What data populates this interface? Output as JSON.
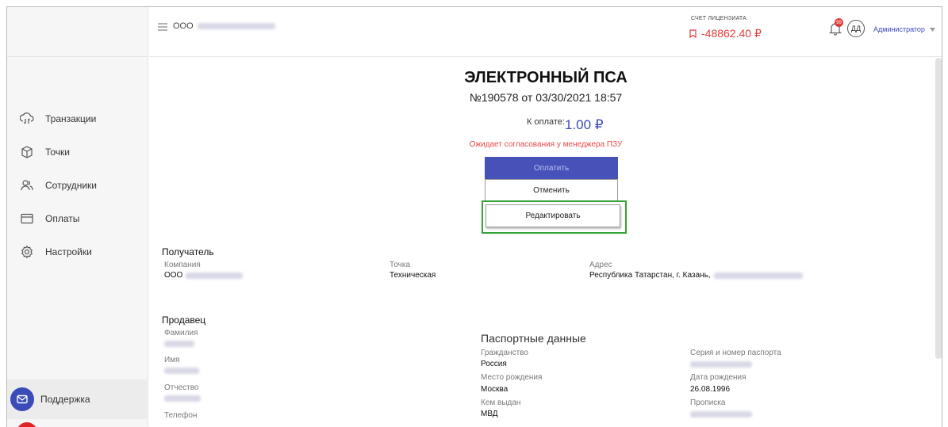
{
  "header": {
    "company_prefix": "ООО",
    "account_label": "СЧЕТ ЛИЦЕНЗИАТА",
    "balance": "-48862.40 ₽",
    "notification_count": "99",
    "avatar_initials": "ДД",
    "user_role": "Администратор"
  },
  "sidebar": {
    "items": [
      {
        "label": "Транзакции",
        "icon": "transactions-icon"
      },
      {
        "label": "Точки",
        "icon": "box-icon"
      },
      {
        "label": "Сотрудники",
        "icon": "users-icon"
      },
      {
        "label": "Оплаты",
        "icon": "card-icon"
      },
      {
        "label": "Настройки",
        "icon": "gear-icon"
      }
    ],
    "support_label": "Поддержка"
  },
  "document": {
    "title": "ЭЛЕКТРОННЫЙ ПСА",
    "subtitle": "№190578 от 03/30/2021 18:57",
    "amount_label": "К оплате:",
    "amount_value": "1.00 ₽",
    "status": "Ожидает согласования у менеджера ПЗУ"
  },
  "actions": {
    "pay": "Оплатить",
    "cancel": "Отменить",
    "edit": "Редактировать"
  },
  "recipient": {
    "heading": "Получатель",
    "company_label": "Компания",
    "company_prefix": "ООО",
    "point_label": "Точка",
    "point_value": "Техническая",
    "address_label": "Адрес",
    "address_value": "Республика Татарстан, г. Казань,"
  },
  "seller": {
    "heading": "Продавец",
    "surname_label": "Фамилия",
    "name_label": "Имя",
    "patronymic_label": "Отчество",
    "phone_label": "Телефон"
  },
  "passport": {
    "heading": "Паспортные данные",
    "citizenship_label": "Гражданство",
    "citizenship_value": "Россия",
    "birthplace_label": "Место рождения",
    "birthplace_value": "Москва",
    "issued_by_label": "Кем выдан",
    "issued_by_value": "МВД",
    "series_label": "Серия и номер паспорта",
    "birthdate_label": "Дата рождения",
    "birthdate_value": "26.08.1996",
    "registration_label": "Прописка"
  },
  "colors": {
    "accent": "#3b4bb8",
    "danger": "#e23b3b",
    "highlight": "#34a234"
  }
}
